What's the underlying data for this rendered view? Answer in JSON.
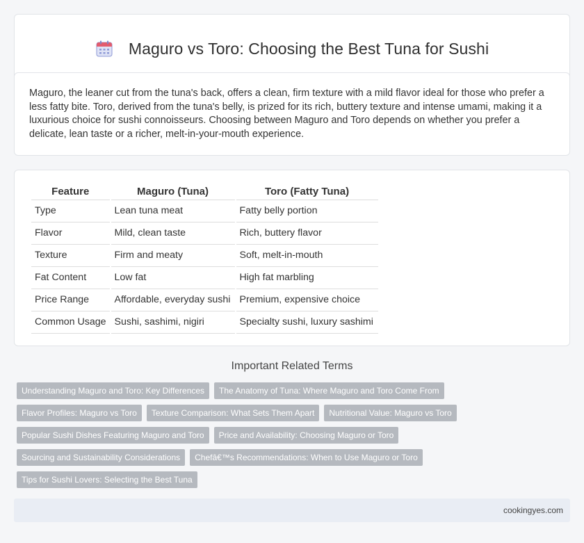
{
  "header": {
    "icon": "calendar-icon",
    "title": "Maguro vs Toro: Choosing the Best Tuna for Sushi"
  },
  "intro": {
    "text": "Maguro, the leaner cut from the tuna's back, offers a clean, firm texture with a mild flavor ideal for those who prefer a less fatty bite. Toro, derived from the tuna's belly, is prized for its rich, buttery texture and intense umami, making it a luxurious choice for sushi connoisseurs. Choosing between Maguro and Toro depends on whether you prefer a delicate, lean taste or a richer, melt-in-your-mouth experience."
  },
  "table": {
    "headers": [
      "Feature",
      "Maguro (Tuna)",
      "Toro (Fatty Tuna)"
    ],
    "rows": [
      [
        "Type",
        "Lean tuna meat",
        "Fatty belly portion"
      ],
      [
        "Flavor",
        "Mild, clean taste",
        "Rich, buttery flavor"
      ],
      [
        "Texture",
        "Firm and meaty",
        "Soft, melt-in-mouth"
      ],
      [
        "Fat Content",
        "Low fat",
        "High fat marbling"
      ],
      [
        "Price Range",
        "Affordable, everyday sushi",
        "Premium, expensive choice"
      ],
      [
        "Common Usage",
        "Sushi, sashimi, nigiri",
        "Specialty sushi, luxury sashimi"
      ]
    ]
  },
  "terms": {
    "title": "Important Related Terms",
    "rows": [
      [
        "Understanding Maguro and Toro: Key Differences",
        "The Anatomy of Tuna: Where Maguro and Toro Come From"
      ],
      [
        "Flavor Profiles: Maguro vs Toro",
        "Texture Comparison: What Sets Them Apart",
        "Nutritional Value: Maguro vs Toro"
      ],
      [
        "Popular Sushi Dishes Featuring Maguro and Toro",
        "Price and Availability: Choosing Maguro or Toro"
      ],
      [
        "Sourcing and Sustainability Considerations",
        "Chefâ€™s Recommendations: When to Use Maguro or Toro"
      ],
      [
        "Tips for Sushi Lovers: Selecting the Best Tuna"
      ]
    ]
  },
  "footer": {
    "site": "cookingyes.com"
  }
}
